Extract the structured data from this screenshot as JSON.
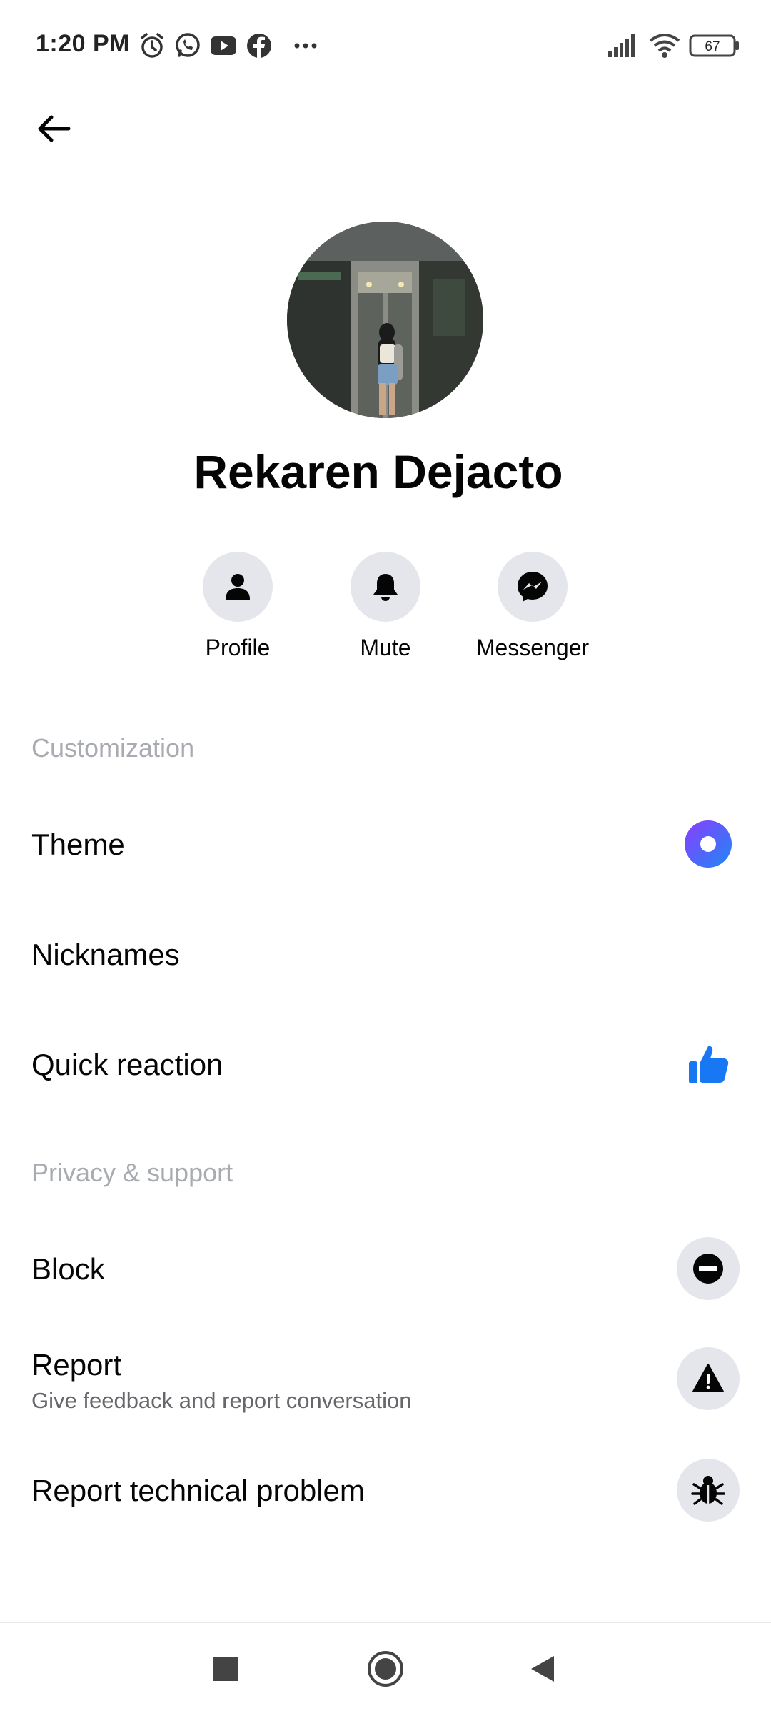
{
  "status": {
    "time": "1:20 PM",
    "battery": "67",
    "icons": [
      "alarm-icon",
      "whatsapp-icon",
      "youtube-icon",
      "facebook-icon",
      "more-dots-icon",
      "signal-icon",
      "wifi-icon",
      "battery-icon"
    ]
  },
  "header": {
    "back_icon": "arrow-left-icon"
  },
  "contact": {
    "name": "Rekaren Dejacto"
  },
  "actions": [
    {
      "label": "Profile",
      "icon": "person-icon"
    },
    {
      "label": "Mute",
      "icon": "bell-icon"
    },
    {
      "label": "Messenger",
      "icon": "messenger-icon"
    }
  ],
  "sections": {
    "customization": "Customization",
    "privacy": "Privacy & support"
  },
  "rows": {
    "theme": "Theme",
    "nicknames": "Nicknames",
    "quick_reaction": "Quick reaction",
    "block": "Block",
    "report": "Report",
    "report_sub": "Give feedback and report conversation",
    "report_technical": "Report technical problem"
  },
  "colors": {
    "theme_gradient_start": "#7b4dff",
    "theme_gradient_end": "#1e88f5",
    "like_blue": "#1877f2",
    "icon_bg": "#e4e6eb",
    "section_gray": "#a8abb0"
  },
  "nav": {
    "icons": [
      "recents-square-icon",
      "home-circle-icon",
      "back-triangle-icon"
    ]
  }
}
